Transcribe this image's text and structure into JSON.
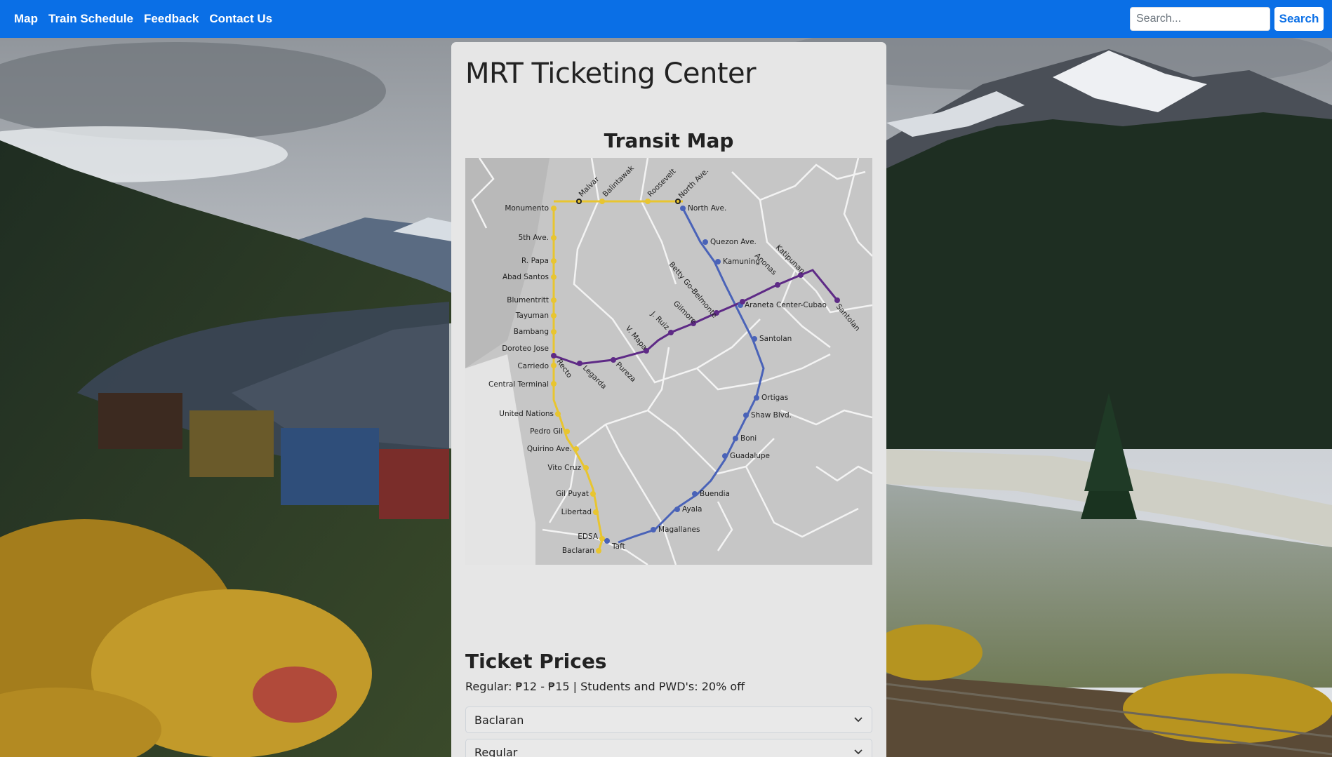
{
  "navbar": {
    "links": [
      {
        "label": "Map"
      },
      {
        "label": "Train Schedule"
      },
      {
        "label": "Feedback"
      },
      {
        "label": "Contact Us"
      }
    ],
    "search_placeholder": "Search...",
    "search_button": "Search"
  },
  "page_title": "MRT Ticketing Center",
  "map": {
    "title": "Transit Map",
    "yellow_stations": [
      "Monumento",
      "5th Ave.",
      "R. Papa",
      "Abad Santos",
      "Blumentritt",
      "Tayuman",
      "Bambang",
      "Doroteo Jose",
      "Carriedo",
      "Central Terminal",
      "United Nations",
      "Pedro Gil",
      "Quirino Ave.",
      "Vito Cruz",
      "Gil Puyat",
      "Libertad",
      "EDSA",
      "Baclaran"
    ],
    "top_stations": [
      "Malvar",
      "Balintawak",
      "Roosevelt",
      "North Ave."
    ],
    "blue_stations": [
      "North Ave.",
      "Quezon Ave.",
      "Kamuning",
      "Araneta Center-Cubao",
      "Santolan",
      "Ortigas",
      "Shaw Blvd.",
      "Boni",
      "Guadalupe",
      "Buendia",
      "Ayala",
      "Magallanes",
      "Taft"
    ],
    "purple_stations": [
      "Recto",
      "Legarda",
      "Pureza",
      "V. Mapa",
      "J. Ruiz",
      "Gilmore",
      "Betty Go-Belmonte",
      "Anonas",
      "Katipunan",
      "Santolan"
    ],
    "colors": {
      "yellow": "#e8c530",
      "blue": "#4a63b8",
      "purple": "#5e2a86",
      "land": "#c8c8c8",
      "borders": "#f2f2f2"
    }
  },
  "prices": {
    "title": "Ticket Prices",
    "text": "Regular: ₱12 - ₱15 | Students and PWD's: 20% off",
    "station_select": "Baclaran",
    "type_select": "Regular"
  }
}
